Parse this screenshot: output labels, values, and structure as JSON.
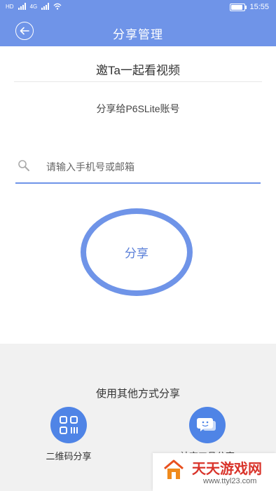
{
  "status_bar": {
    "left_labels": [
      "HD",
      "4G",
      "46"
    ],
    "time": "15:55"
  },
  "header": {
    "title": "分享管理"
  },
  "invite": {
    "title": "邀Ta一起看视频",
    "share_to": "分享给P6SLite账号"
  },
  "search": {
    "placeholder": "请输入手机号或邮箱",
    "value": ""
  },
  "share_button": {
    "label": "分享"
  },
  "other": {
    "title": "使用其他方式分享",
    "options": [
      {
        "label": "二维码分享",
        "icon": "qr-code-icon"
      },
      {
        "label": "社交工具分享",
        "icon": "chat-bubble-icon"
      }
    ]
  },
  "watermark": {
    "title": "天天游戏网",
    "url": "www.ttyl23.com"
  },
  "colors": {
    "primary": "#6f94e8",
    "icon_blue": "#4f84e6",
    "bottom_bg": "#f1f1f1",
    "watermark_red": "#d9342b"
  }
}
